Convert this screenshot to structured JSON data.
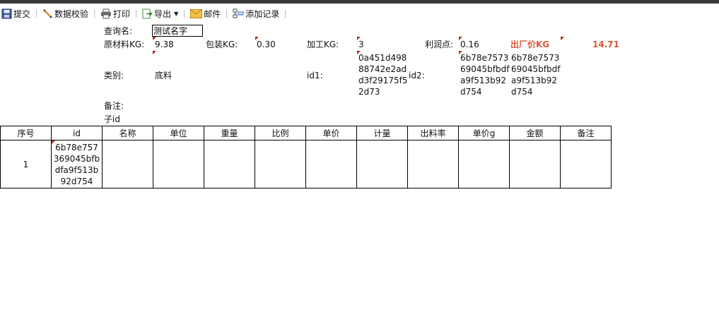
{
  "toolbar": {
    "submit": "提交",
    "validate": "数据校验",
    "print": "打印",
    "export": "导出",
    "mail": "邮件",
    "add_record": "添加记录"
  },
  "form": {
    "query_name_label": "查询名:",
    "query_name_value": "测试名字",
    "raw_kg_label": "原材料KG:",
    "raw_kg_value": "9.38",
    "pack_kg_label": "包装KG:",
    "pack_kg_value": "0.30",
    "process_kg_label": "加工KG:",
    "process_kg_value": "3",
    "profit_label": "利润点:",
    "profit_value": "0.16",
    "factory_price_label": "出厂价KG",
    "factory_price_value": "14.71",
    "category_label": "类别:",
    "category_value": "底料",
    "id1_label": "id1:",
    "id1_value": "0a451d49888742e2add3f29175f52d73",
    "id2_label": "id2:",
    "id2_value": "6b78e757369045bfbdfa9f513b92d754",
    "id2_copy_value": "6b78e757369045bfbdfa9f513b92d754",
    "remark_label": "备注:",
    "child_id_label": "子id"
  },
  "table": {
    "headers": [
      "序号",
      "id",
      "名称",
      "单位",
      "重量",
      "比例",
      "单价",
      "计量",
      "出料率",
      "单价g",
      "金额",
      "备注"
    ],
    "rows": [
      [
        "1",
        "6b78e757369045bfbdfa9f513b92d754",
        "",
        "",
        "",
        "",
        "",
        "",
        "",
        "",
        "",
        ""
      ]
    ]
  },
  "colors": {
    "accent_red": "#d9573a",
    "mark_red": "#b02a1a"
  }
}
